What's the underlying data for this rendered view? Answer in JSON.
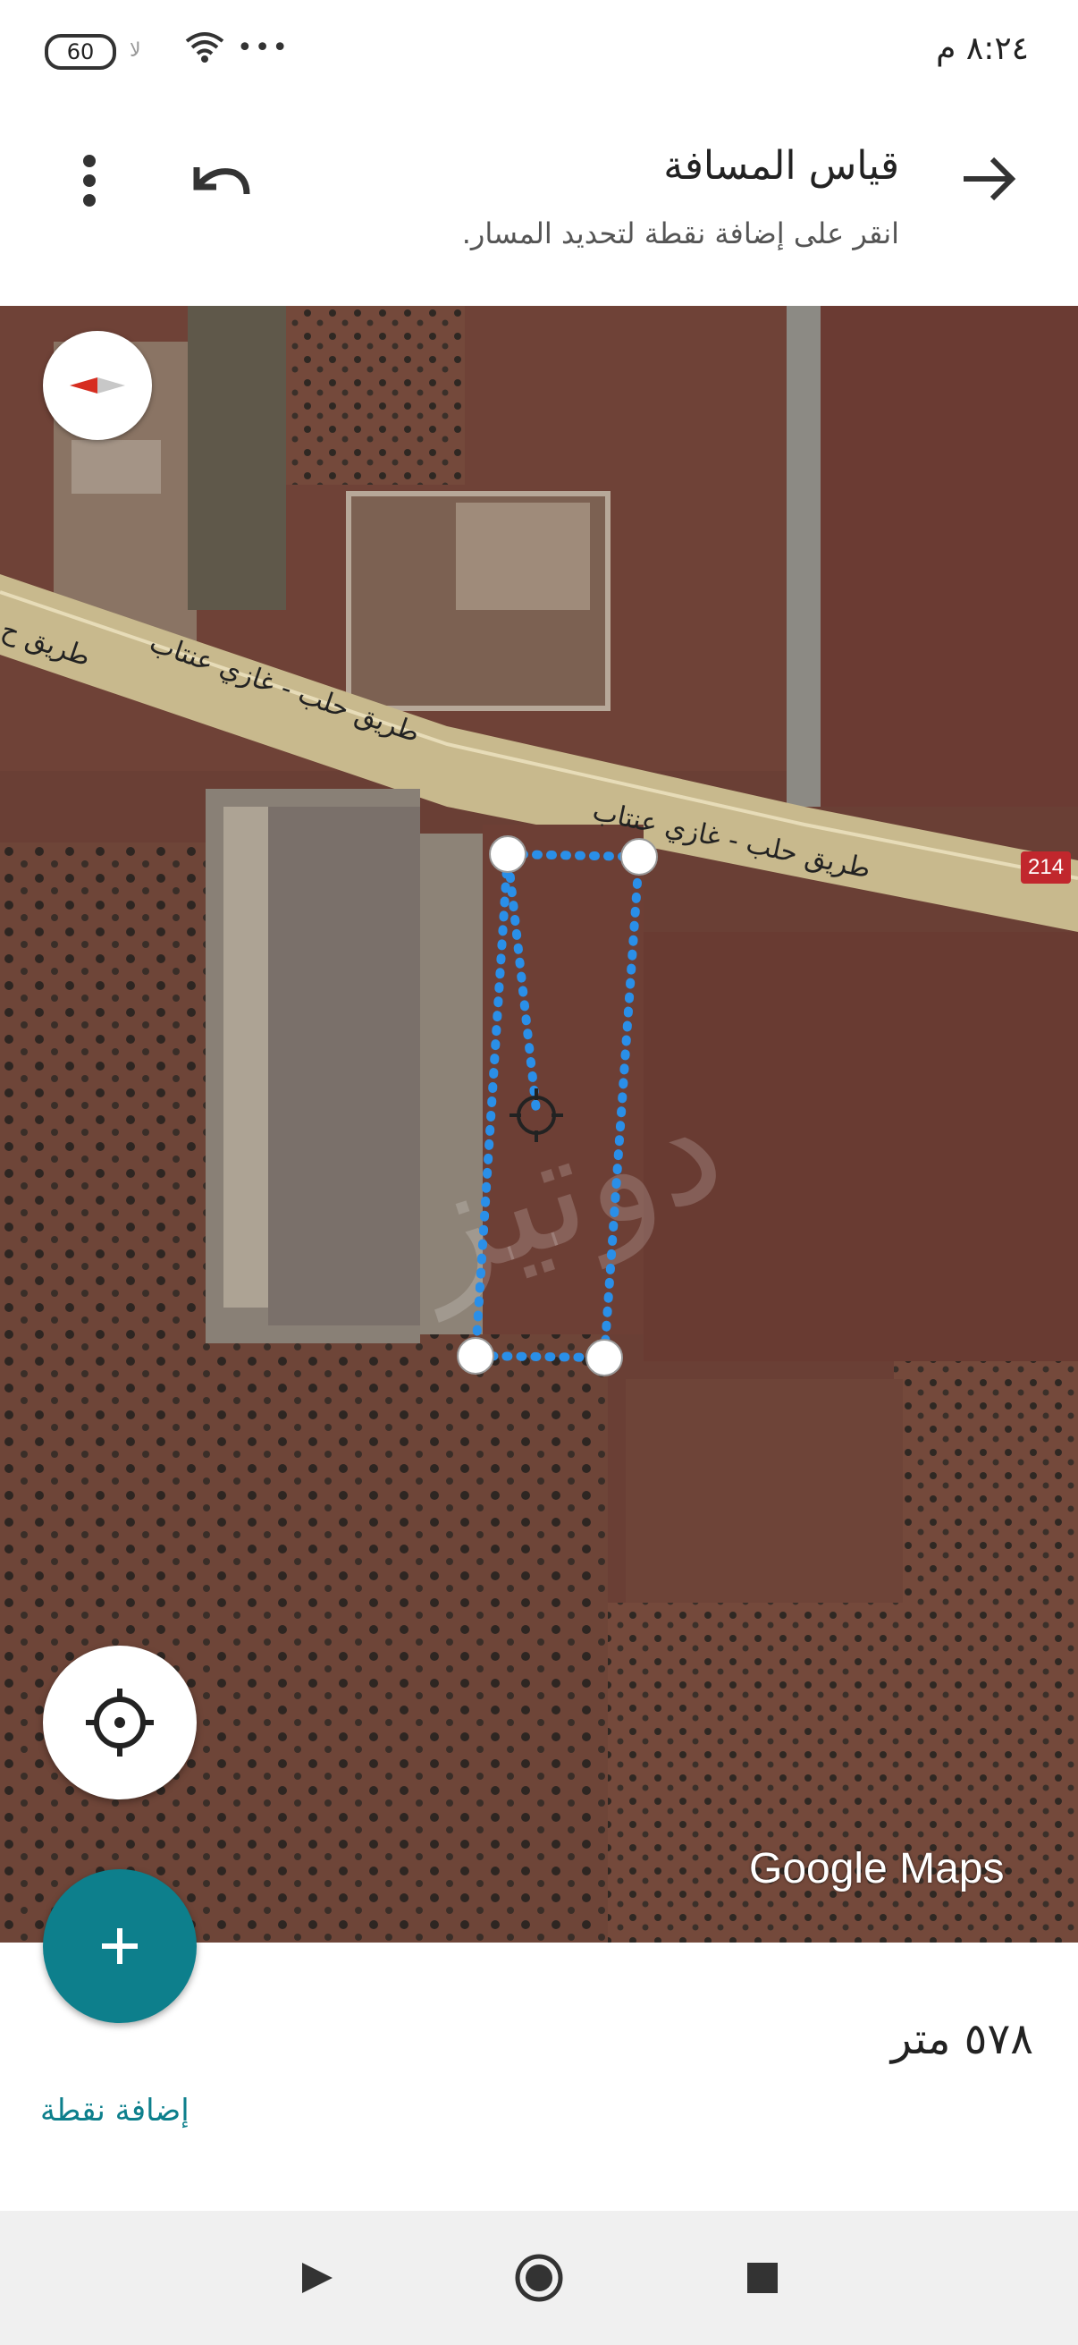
{
  "status_bar": {
    "time": "٨:٢٤ م",
    "battery": "60",
    "signal_text": "لا"
  },
  "toolbar": {
    "title": "قياس المسافة",
    "subtitle": "انقر على إضافة نقطة لتحديد المسار."
  },
  "map": {
    "road_label_1": "طريق حلب - غازي عنتاب",
    "road_label_2": "طريق حلب - غازي عنتاب",
    "road_label_3": "طريق ح",
    "road_number": "214",
    "attribution": "Google Maps"
  },
  "bottom_panel": {
    "distance": "٥٧٨ متر",
    "add_point_label": "إضافة نقطة"
  },
  "colors": {
    "accent": "#0d7f8c",
    "measure_line": "#2a8fe8"
  },
  "icons": {
    "back": "arrow-right-icon",
    "undo": "undo-icon",
    "menu": "more-vert-icon",
    "compass": "compass-icon",
    "locate": "crosshair-icon",
    "add": "plus-icon",
    "nav_back": "triangle-back-icon",
    "nav_home": "circle-home-icon",
    "nav_recents": "square-recents-icon"
  }
}
